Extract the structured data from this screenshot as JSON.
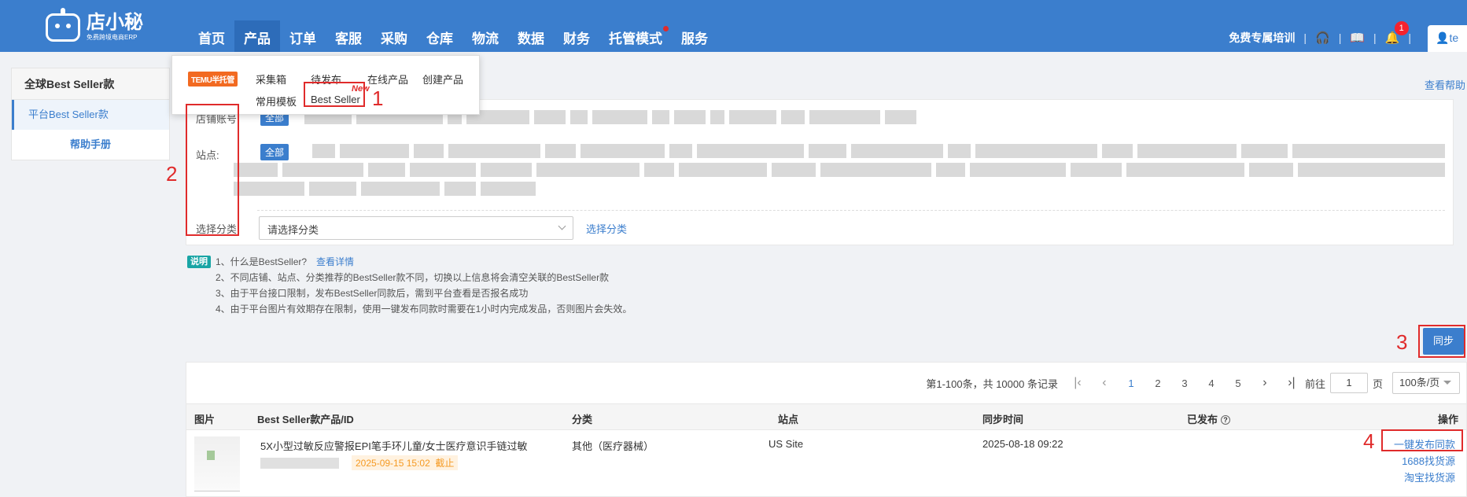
{
  "app": {
    "logo_name": "店小秘",
    "logo_sub": "免费跨境电商ERP"
  },
  "nav": {
    "items": [
      {
        "label": "首页"
      },
      {
        "label": "产品"
      },
      {
        "label": "订单"
      },
      {
        "label": "客服"
      },
      {
        "label": "采购"
      },
      {
        "label": "仓库"
      },
      {
        "label": "物流"
      },
      {
        "label": "数据"
      },
      {
        "label": "财务"
      },
      {
        "label": "托管模式"
      },
      {
        "label": "服务"
      }
    ],
    "active_index": 1
  },
  "topright": {
    "training": "免费专属培训",
    "bell_count": "1",
    "user": "te"
  },
  "dropdown": {
    "logo": "TEMU半托管",
    "items": [
      "采集箱",
      "待发布",
      "在线产品",
      "创建产品",
      "常用模板",
      "Best Seller"
    ],
    "new_tag": "New"
  },
  "sidebar": {
    "header": "全球Best Seller款",
    "active_item": "平台Best Seller款",
    "help": "帮助手册"
  },
  "help_link": "查看帮助",
  "filters": {
    "shop_label": "店铺账号",
    "site_label": "站点:",
    "all_tag": "全部",
    "category_label": "选择分类",
    "category_placeholder": "请选择分类",
    "category_link": "选择分类"
  },
  "notes": {
    "badge": "说明",
    "lines": [
      "1、什么是BestSeller?",
      "2、不同店铺、站点、分类推荐的BestSeller款不同，切换以上信息将会清空关联的BestSeller款",
      "3、由于平台接口限制，发布BestSeller同款后，需到平台查看是否报名成功",
      "4、由于平台图片有效期存在限制，使用一键发布同款时需要在1小时内完成发品，否则图片会失效。"
    ],
    "detail_link": "查看详情"
  },
  "sync_button": "同步",
  "pager": {
    "summary": "第1-100条，共 10000 条记录",
    "pages": [
      "1",
      "2",
      "3",
      "4",
      "5"
    ],
    "current": "1",
    "goto_label": "前往",
    "goto_value": "1",
    "page_unit": "页",
    "page_size": "100条/页"
  },
  "table": {
    "headers": [
      "图片",
      "Best Seller款产品/ID",
      "分类",
      "站点",
      "同步时间",
      "已发布",
      "操作"
    ],
    "rows": [
      {
        "name": "5X小型过敏反应警报EPI笔手环儿童/女士医疗意识手链过敏",
        "deadline": "2025-09-15 15:02",
        "deadline_suffix": "截止",
        "category": "其他（医疗器械）",
        "site": "US Site",
        "sync_time": "2025-08-18 09:22",
        "actions": [
          "一键发布同款",
          "1688找货源",
          "淘宝找货源"
        ]
      }
    ]
  },
  "annotations": [
    "1",
    "2",
    "3",
    "4"
  ]
}
